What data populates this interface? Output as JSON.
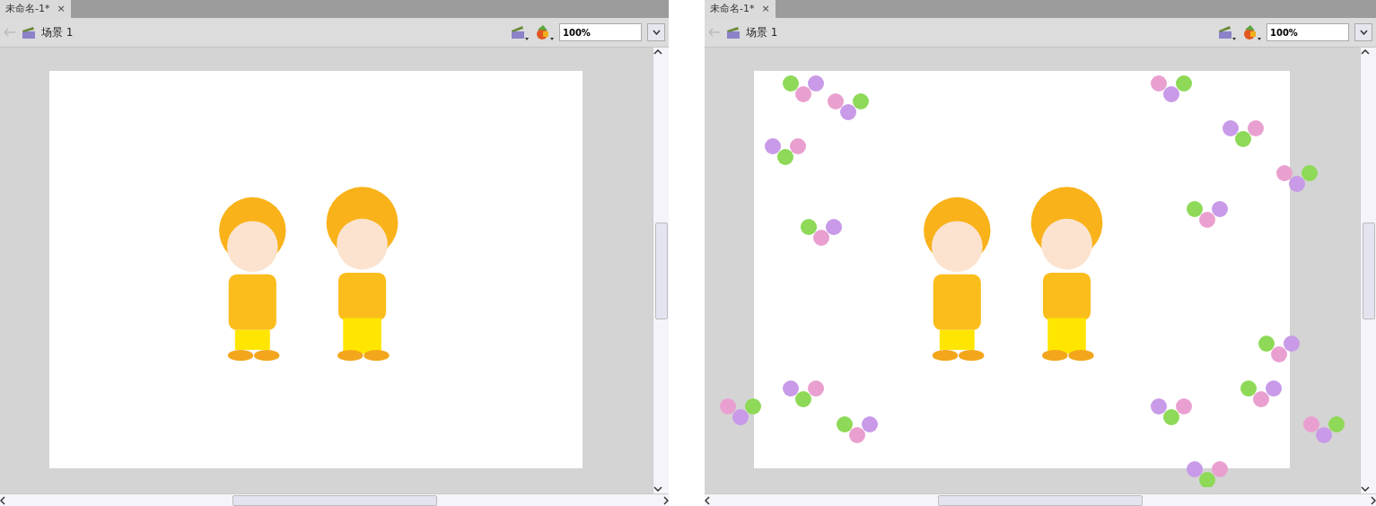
{
  "panels": [
    {
      "tab": {
        "title": "未命名-1*",
        "close": "×",
        "selected": true
      },
      "scene": "场景 1",
      "zoom": "100%",
      "flowers": false
    },
    {
      "tab": {
        "title": "未命名-1*",
        "close": "×",
        "selected": true
      },
      "scene": "场景 1",
      "zoom": "100%",
      "flowers": true
    }
  ]
}
